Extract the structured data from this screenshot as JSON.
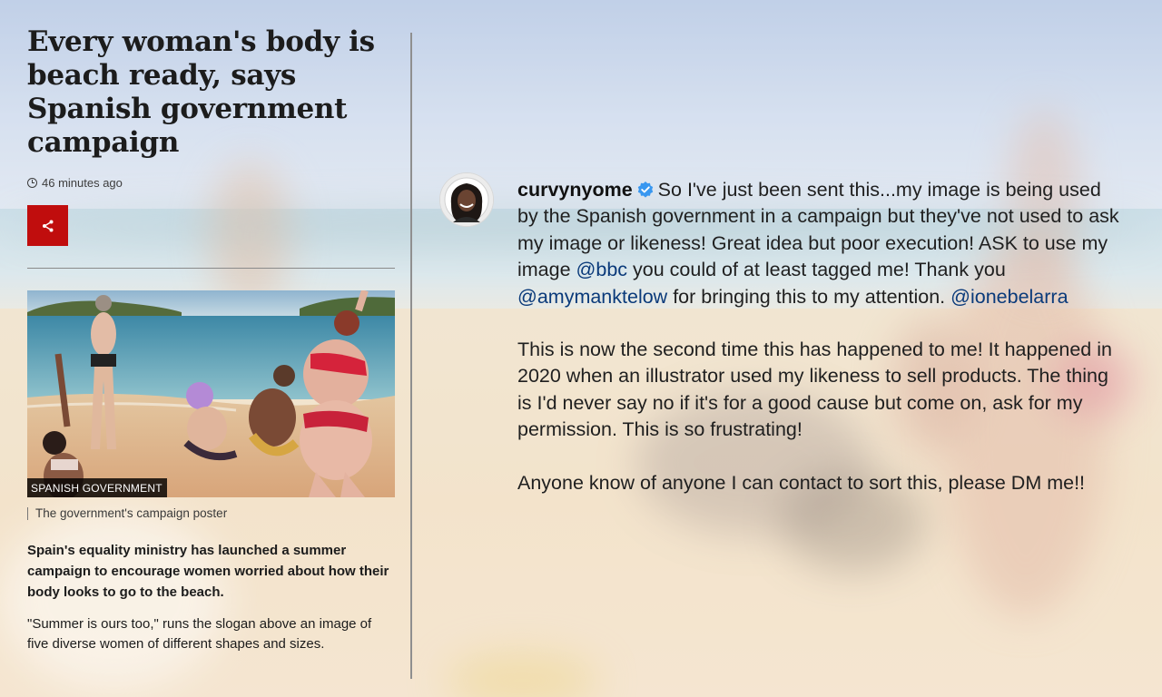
{
  "article": {
    "headline": "Every woman's body is beach ready, says Spanish government campaign",
    "timestamp": "46 minutes ago",
    "share_icon": "share-icon",
    "image_label": "SPANISH GOVERNMENT",
    "image_caption": "The government's campaign poster",
    "lede": "Spain's equality ministry has launched a summer campaign to encourage women worried about how their body looks to go to the beach.",
    "paragraph": "\"Summer is ours too,\" runs the slogan above an image of five diverse women of different shapes and sizes."
  },
  "post": {
    "username": "curvynyome",
    "p1_a": "So I've just been sent this...my image is being used by the Spanish government in a campaign but they've not used to ask my image or likeness! Great idea but poor execution! ASK to use my image ",
    "mention_1": "@bbc",
    "p1_b": " you could of at least tagged me! Thank you ",
    "mention_2": "@amymanktelow",
    "p1_c": " for bringing this to my attention. ",
    "mention_3": "@ionebelarra",
    "p2": "This is now the second time this has happened to me! It happened in 2020 when an illustrator used my likeness to sell products. The thing is I'd never say no if it's for a good cause but come on, ask for my permission. This is so frustrating!",
    "p3": "Anyone know of anyone I can contact to sort this, please DM me!!"
  },
  "colors": {
    "share_red": "#c00d0d",
    "mention_blue": "#0a3a7a",
    "verified_blue": "#3897f0"
  }
}
